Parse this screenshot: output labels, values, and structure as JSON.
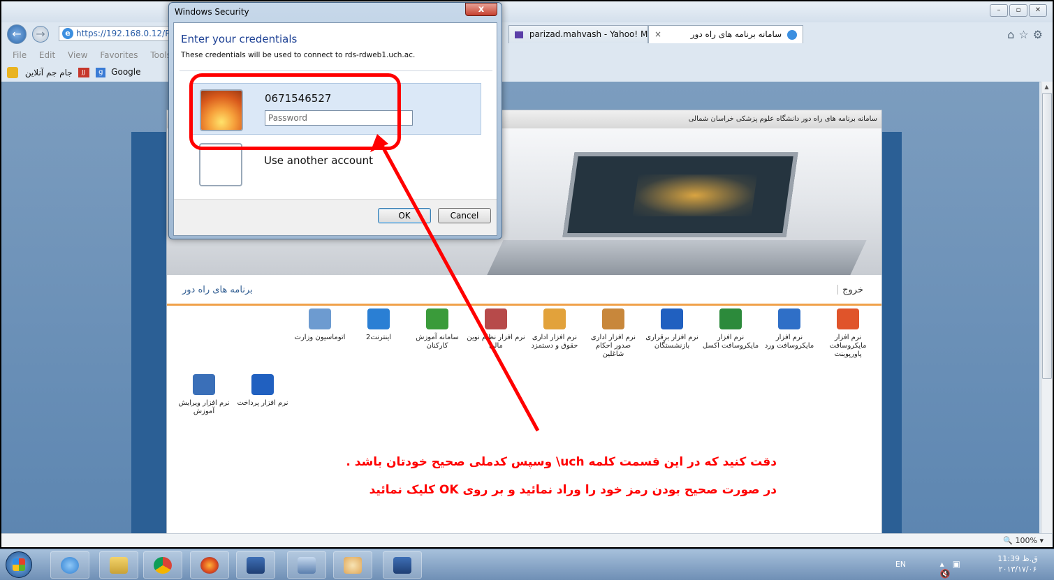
{
  "browser": {
    "address": "https://192.168.0.12/R",
    "tabs": [
      {
        "label": "parizad.mahvash - Yahoo! Mail"
      },
      {
        "label": "سامانه برنامه های راه دور",
        "close": "×"
      }
    ],
    "menu": [
      "File",
      "Edit",
      "View",
      "Favorites",
      "Tools"
    ],
    "favorites": {
      "google": "Google",
      "jamejam": "جام جم آنلاین"
    },
    "zoom": "100%"
  },
  "site": {
    "header": "سامانه برنامه های راه دور دانشگاه علوم پزشکی خراسان شمالی",
    "nav_title": "برنامه های راه دور",
    "nav_exit": "خروج",
    "apps": [
      {
        "label": "نرم افزار مایکروسافت پاورپوینت",
        "color": "#e0542a"
      },
      {
        "label": "نرم افزار مایکروسافت ورد",
        "color": "#2f6fc7"
      },
      {
        "label": "نرم افزار مایکروسافت اکسل",
        "color": "#2c8a3b"
      },
      {
        "label": "نرم افزار برقراری بازنشستگان",
        "color": "#2060c0"
      },
      {
        "label": "نرم افزار اداری صدور احکام شاغلین",
        "color": "#c8873b"
      },
      {
        "label": "نرم افزار اداری حقوق و دستمزد",
        "color": "#e2a23b"
      },
      {
        "label": "نرم افزار نظام نوین مالی",
        "color": "#b74a4a"
      },
      {
        "label": "سامانه آموزش کارکنان",
        "color": "#3a9b3a"
      },
      {
        "label": "اینترنت2",
        "color": "#2a7fd4"
      },
      {
        "label": "اتوماسیون وزارت",
        "color": "#6d9bd0"
      },
      {
        "label": "نرم افزار پرداخت",
        "color": "#2060c0"
      },
      {
        "label": "نرم افزار ویرایش آموزش",
        "color": "#3a6fb8"
      }
    ]
  },
  "dialog": {
    "title": "Windows Security",
    "close": "x",
    "heading": "Enter your credentials",
    "subtitle": "These credentials will be used to connect to rds-rdweb1.uch.ac.",
    "account": "0671546527",
    "password_placeholder": "Password",
    "other_account": "Use another account",
    "ok": "OK",
    "cancel": "Cancel"
  },
  "annotation": {
    "line1": "دقت کنید که در این قسمت کلمه uch\\ وسپس کدملی صحیح خودتان باشد .",
    "line2": "در صورت صحیح بودن رمز خود را وراد نمائید و بر روی OK کلیک نمائید",
    "color": "#ff0000"
  },
  "taskbar": {
    "lang": "EN",
    "time": "11:39 ق.ظ",
    "date": "۲۰۱۳/۱۷/۰۶"
  }
}
